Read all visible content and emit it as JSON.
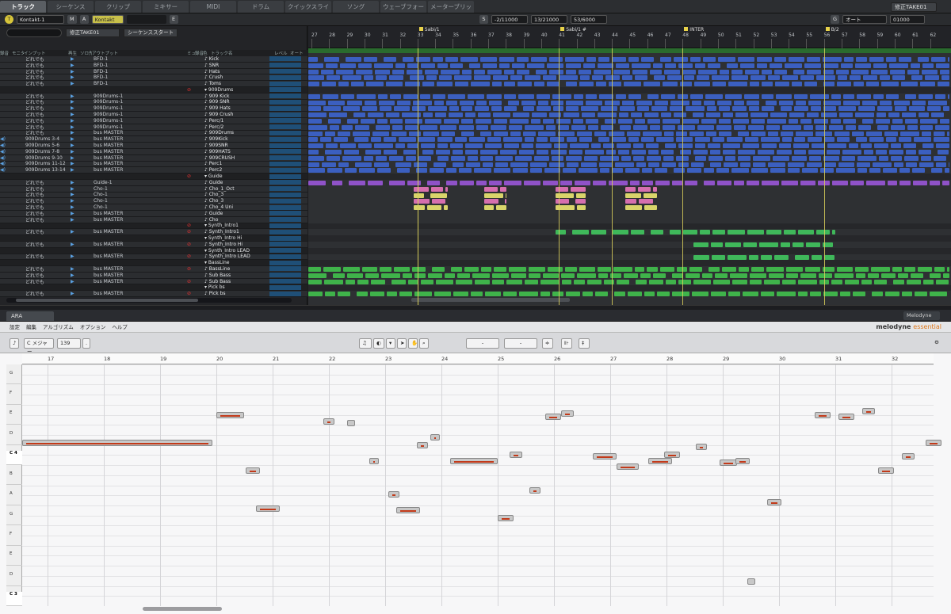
{
  "tabs": [
    "トラック",
    "シーケンス",
    "クリップ",
    "ミキサー",
    "MIDI",
    "ドラム",
    "クイックスライプ",
    "ソング",
    "ウェーブフォーム",
    "メーターブリッジ"
  ],
  "take_select": "修正TAKE01",
  "toolbar": {
    "instrument": "Kontakt-1",
    "instrument_name": "Kontakt",
    "m_label": "M",
    "a_label": "A",
    "e_label": "E",
    "s_label": "S",
    "pos_start": "-2/11000",
    "pos_mid": "13/21000",
    "pos_end": "53/6000",
    "g_label": "G",
    "auto_label": "オート",
    "time_value": "01000"
  },
  "header": {
    "search_placeholder": "",
    "take": "修正TAKE01",
    "sequence": "シーケンススタート",
    "columns": [
      "録音",
      "モニタ",
      "インプット",
      "再生",
      "ソロ先取",
      "アウトプット",
      "ミュート",
      "録音",
      "色",
      "トラック名",
      "レベル",
      "オート"
    ]
  },
  "tracks": [
    {
      "input": "どれでも",
      "output": "BFD-1",
      "name": "Kick",
      "folder": false,
      "rec": false
    },
    {
      "input": "どれでも",
      "output": "BFD-1",
      "name": "SNR",
      "folder": false,
      "rec": false
    },
    {
      "input": "どれでも",
      "output": "BFD-1",
      "name": "Hats",
      "folder": false,
      "rec": false
    },
    {
      "input": "どれでも",
      "output": "BFD-1",
      "name": "Crush",
      "folder": false,
      "rec": false
    },
    {
      "input": "どれでも",
      "output": "BFD-1",
      "name": "Toms",
      "folder": false,
      "rec": false
    },
    {
      "input": "",
      "output": "",
      "name": "909Drums",
      "folder": true,
      "rec": true
    },
    {
      "input": "どれでも",
      "output": "909Drums-1",
      "name": "909 Kick",
      "folder": false,
      "rec": false
    },
    {
      "input": "どれでも",
      "output": "909Drums-1",
      "name": "909 SNR",
      "folder": false,
      "rec": false
    },
    {
      "input": "どれでも",
      "output": "909Drums-1",
      "name": "909 Hats",
      "folder": false,
      "rec": false
    },
    {
      "input": "どれでも",
      "output": "909Drums-1",
      "name": "909 Crush",
      "folder": false,
      "rec": false
    },
    {
      "input": "どれでも",
      "output": "909Drums-1",
      "name": "Perc/1",
      "folder": false,
      "rec": false
    },
    {
      "input": "どれでも",
      "output": "909Drums-1",
      "name": "Perc/2",
      "folder": false,
      "rec": false
    },
    {
      "input": "どれでも",
      "output": "bus MASTER",
      "name": "909Drums",
      "folder": false,
      "rec": false
    },
    {
      "input": "909Drums 3-4",
      "output": "bus MASTER",
      "name": "909Kick",
      "folder": false,
      "rec": false
    },
    {
      "input": "909Drums 5-6",
      "output": "bus MASTER",
      "name": "909SNR",
      "folder": false,
      "rec": false
    },
    {
      "input": "909Drums 7-8",
      "output": "bus MASTER",
      "name": "909HATS",
      "folder": false,
      "rec": false
    },
    {
      "input": "909Drums 9-10",
      "output": "bus MASTER",
      "name": "909CRUSH",
      "folder": false,
      "rec": false
    },
    {
      "input": "909Drums 11-12",
      "output": "bus MASTER",
      "name": "Perc1",
      "folder": false,
      "rec": false
    },
    {
      "input": "909Drums 13-14",
      "output": "bus MASTER",
      "name": "Perc2",
      "folder": false,
      "rec": false
    },
    {
      "input": "",
      "output": "",
      "name": "Guide",
      "folder": true,
      "rec": true
    },
    {
      "input": "どれでも",
      "output": "Guide-1",
      "name": "Guide",
      "folder": false,
      "rec": false
    },
    {
      "input": "どれでも",
      "output": "Cho-1",
      "name": "Cho_1_Oct",
      "folder": false,
      "rec": false
    },
    {
      "input": "どれでも",
      "output": "Cho-1",
      "name": "Cho_3",
      "folder": false,
      "rec": false
    },
    {
      "input": "どれでも",
      "output": "Cho-1",
      "name": "Cho_3",
      "folder": false,
      "rec": false
    },
    {
      "input": "どれでも",
      "output": "Cho-1",
      "name": "Cho_4 Uni",
      "folder": false,
      "rec": false
    },
    {
      "input": "どれでも",
      "output": "bus MASTER",
      "name": "Guide",
      "folder": false,
      "rec": false
    },
    {
      "input": "どれでも",
      "output": "bus MASTER",
      "name": "Cho",
      "folder": false,
      "rec": false
    },
    {
      "input": "",
      "output": "",
      "name": "Synth_Intro1",
      "folder": true,
      "rec": true
    },
    {
      "input": "どれでも",
      "output": "bus MASTER",
      "name": "Synth_Intro1",
      "folder": false,
      "rec": true
    },
    {
      "input": "",
      "output": "",
      "name": "Synth_Intro Hi",
      "folder": true,
      "rec": false
    },
    {
      "input": "どれでも",
      "output": "bus MASTER",
      "name": "Synth_Intro Hi",
      "folder": false,
      "rec": true
    },
    {
      "input": "",
      "output": "",
      "name": "Synth_Intro LEAD",
      "folder": true,
      "rec": false
    },
    {
      "input": "どれでも",
      "output": "bus MASTER",
      "name": "Synth_Intro LEAD",
      "folder": false,
      "rec": true
    },
    {
      "input": "",
      "output": "",
      "name": "BassLine",
      "folder": true,
      "rec": false
    },
    {
      "input": "どれでも",
      "output": "bus MASTER",
      "name": "BassLine",
      "folder": false,
      "rec": true
    },
    {
      "input": "どれでも",
      "output": "bus MASTER",
      "name": "Sub Bass",
      "folder": false,
      "rec": false
    },
    {
      "input": "どれでも",
      "output": "bus MASTER",
      "name": "Sub Bass",
      "folder": false,
      "rec": true
    },
    {
      "input": "",
      "output": "",
      "name": "Pick bs",
      "folder": true,
      "rec": false
    },
    {
      "input": "どれでも",
      "output": "bus MASTER",
      "name": "Pick bs",
      "folder": false,
      "rec": true
    }
  ],
  "ruler": {
    "bars": [
      "27",
      "28",
      "29",
      "30",
      "31",
      "32",
      "33",
      "34",
      "35",
      "36",
      "37",
      "38",
      "39",
      "40",
      "41",
      "42",
      "43",
      "44",
      "45",
      "46",
      "47",
      "48",
      "49",
      "50",
      "51",
      "52",
      "53",
      "54",
      "55",
      "56",
      "57",
      "58",
      "59",
      "60",
      "61",
      "62"
    ],
    "markers": [
      {
        "label": "",
        "bar": 33
      },
      {
        "label": "Sabi/1",
        "bar": 33
      },
      {
        "label": "Sabi/1 #",
        "bar": 41
      },
      {
        "label": "",
        "bar": 44
      },
      {
        "label": "INTER",
        "bar": 48
      },
      {
        "label": "B/2",
        "bar": 56
      }
    ]
  },
  "clip_colors": {
    "drums": "#3b5fc0",
    "guide": "#8f52c8",
    "cho_pink": "#d66fae",
    "cho_yellow": "#d9d46a",
    "synth": "#3fb85a",
    "bass": "#3fb34a",
    "overview": "#2f7a34"
  },
  "ara": {
    "tab": "ARA",
    "plugin": "Melodyne"
  },
  "melodyne": {
    "menu": [
      "設定",
      "編集",
      "アルゴリズム",
      "オプション",
      "ヘルプ"
    ],
    "logo_main": "melodyne",
    "logo_sub": "essential",
    "scale": "C メジャー",
    "tempo": "139",
    "tempo_unit": ".",
    "field_a": "-",
    "field_b": "-",
    "bars": [
      "17",
      "18",
      "19",
      "20",
      "21",
      "22",
      "23",
      "24",
      "25",
      "26",
      "27",
      "28",
      "29",
      "30",
      "31",
      "32"
    ],
    "keys": [
      "G",
      "F",
      "E",
      "D",
      "C 4",
      "B",
      "A",
      "G",
      "F",
      "E",
      "D",
      "C 3"
    ]
  }
}
